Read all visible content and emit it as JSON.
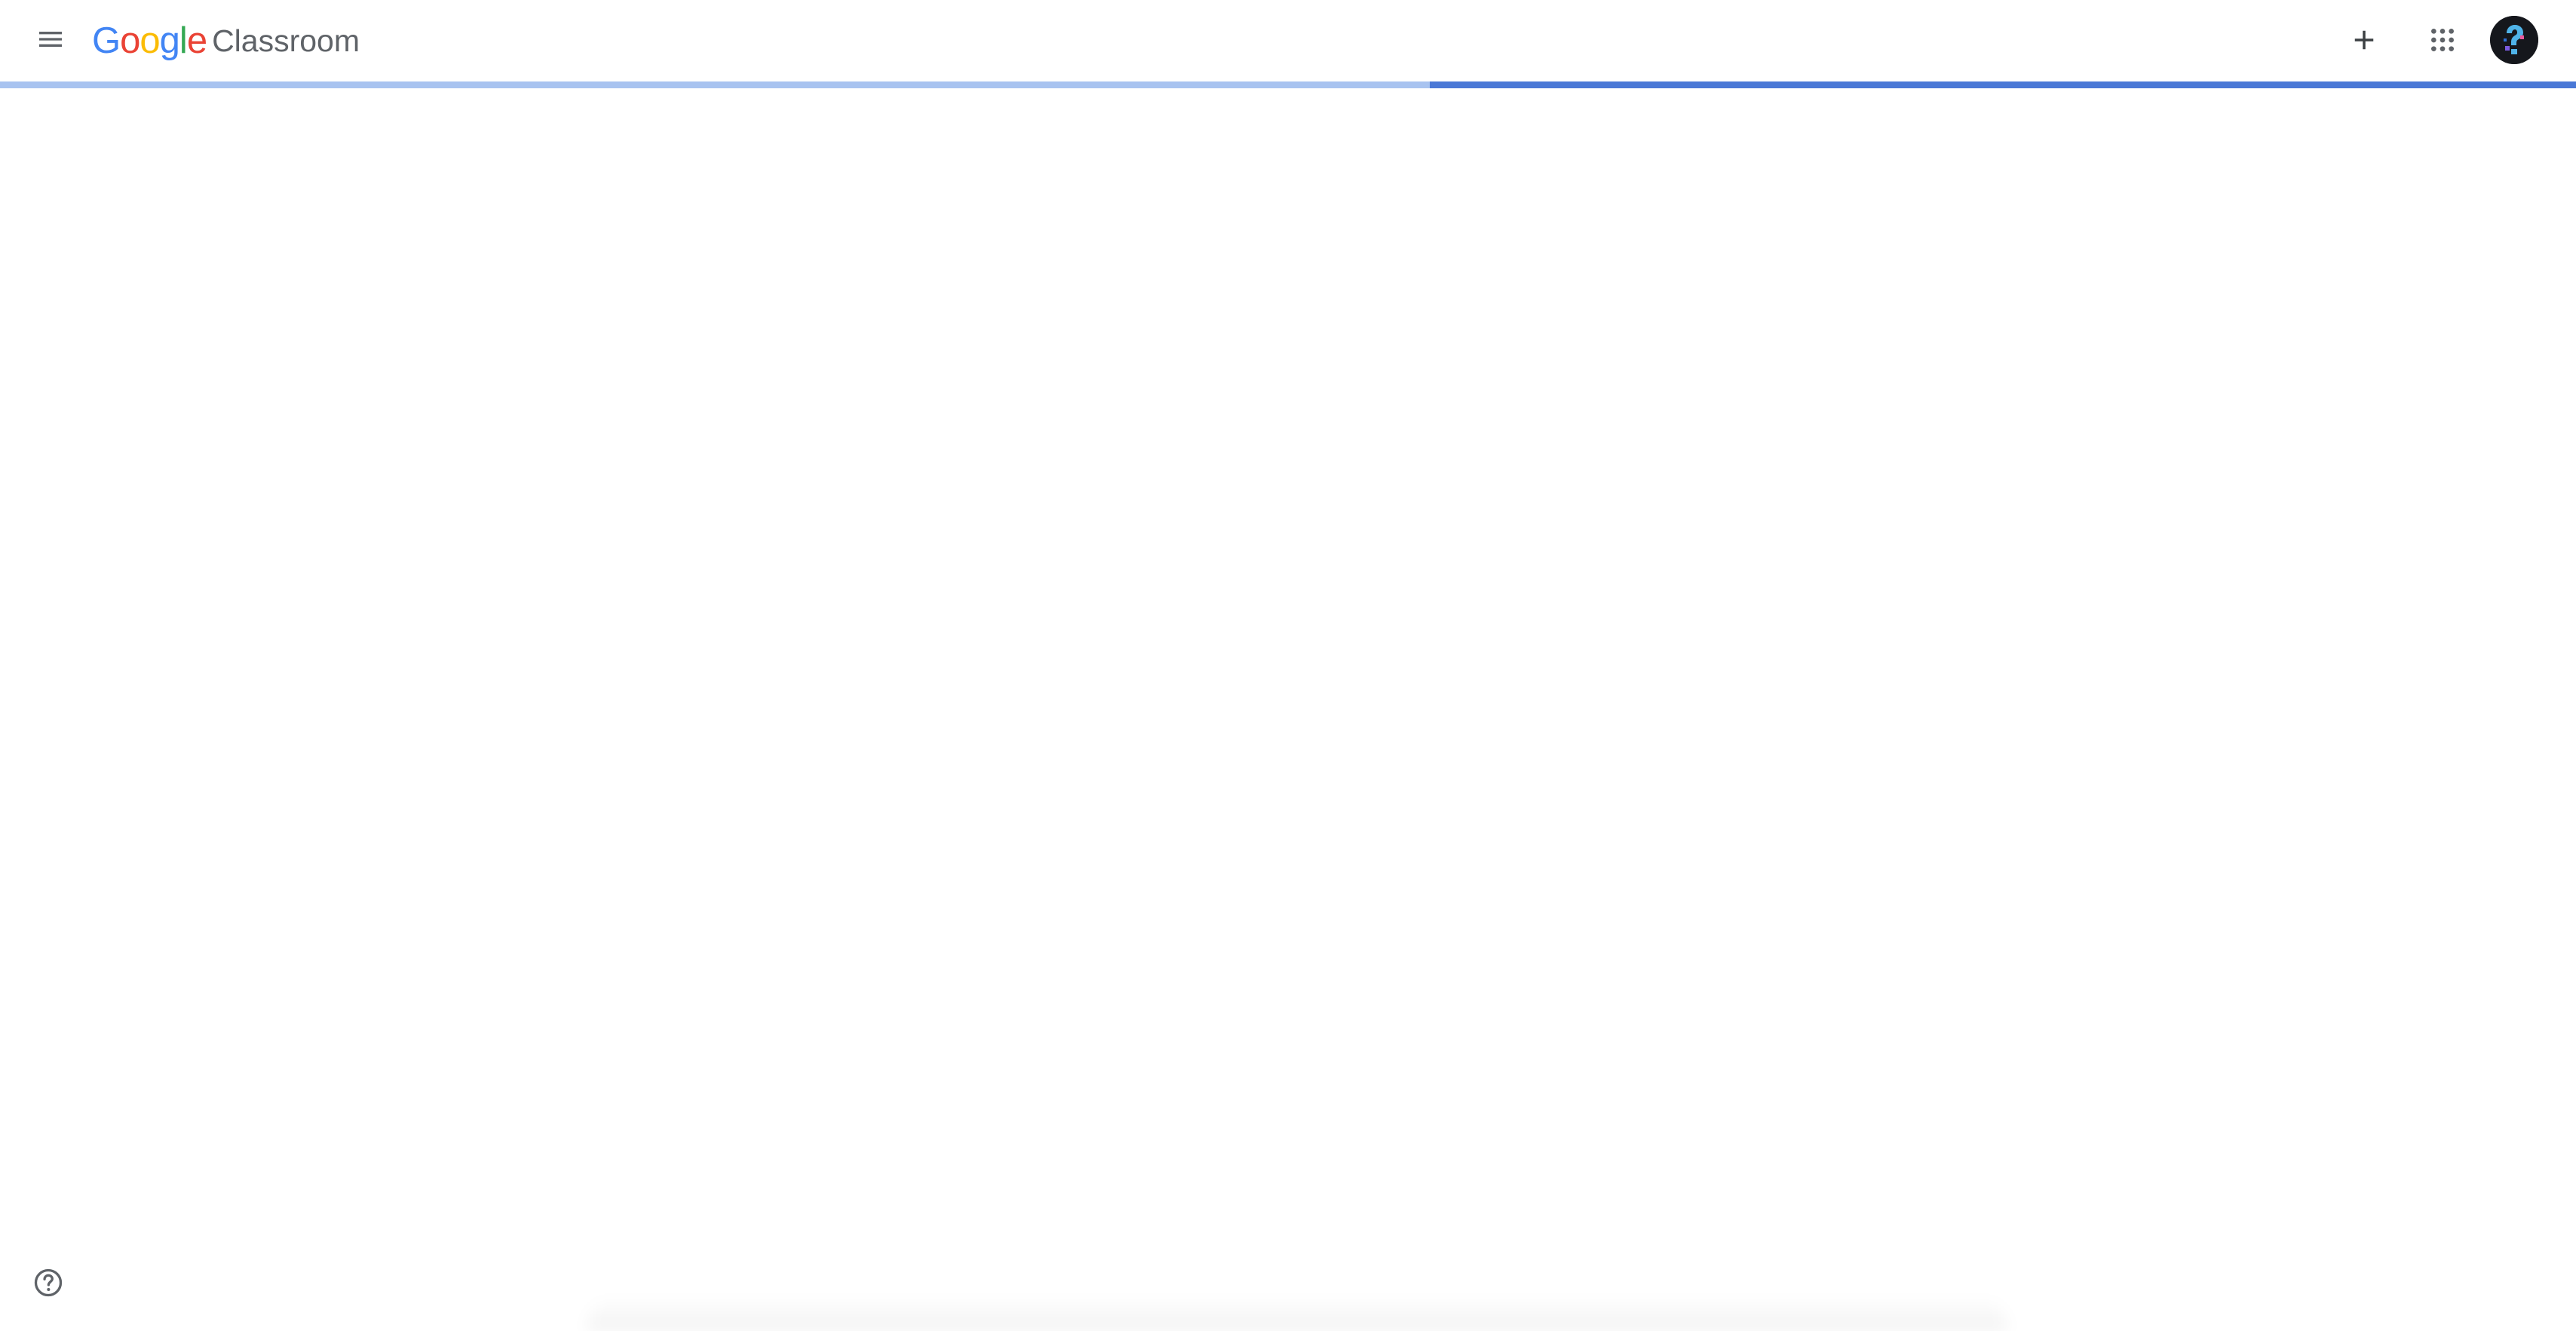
{
  "header": {
    "logo": {
      "google_letters": [
        {
          "char": "G",
          "color": "#4285F4"
        },
        {
          "char": "o",
          "color": "#EA4335"
        },
        {
          "char": "o",
          "color": "#FBBC05"
        },
        {
          "char": "g",
          "color": "#4285F4"
        },
        {
          "char": "l",
          "color": "#34A853"
        },
        {
          "char": "e",
          "color": "#EA4335"
        }
      ],
      "product": "Classroom"
    },
    "icons": {
      "menu": "hamburger-menu-icon",
      "add": "plus-icon",
      "apps": "apps-grid-icon",
      "account": "avatar"
    }
  },
  "progress": {
    "fraction": 0.445,
    "track_color": "#A8C3F0",
    "bar_color": "#4A78D6"
  },
  "footer": {
    "help_icon": "help-circle-icon"
  },
  "colors": {
    "icon": "#5f6368",
    "background": "#ffffff"
  }
}
